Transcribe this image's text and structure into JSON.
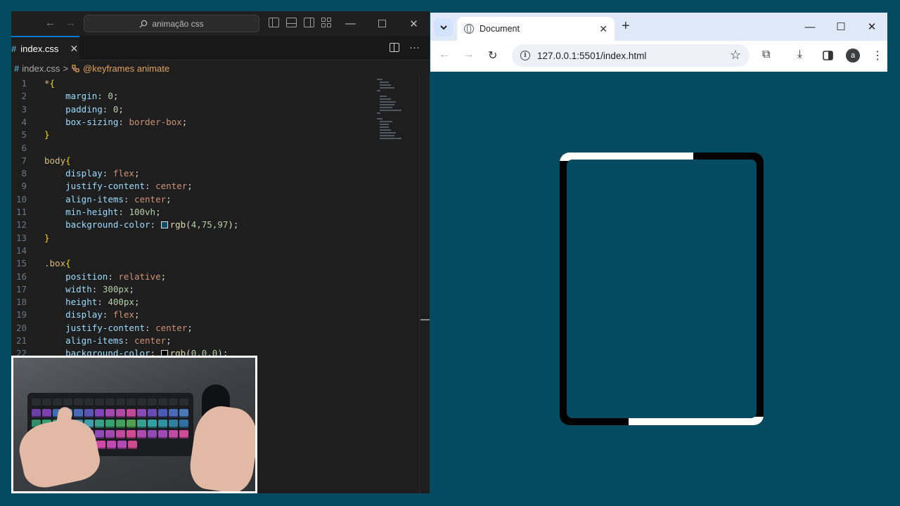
{
  "editor": {
    "nav": {
      "back": "←",
      "forward": "→"
    },
    "search_text": "animação css",
    "window_controls": [
      "—",
      "☐",
      "✕"
    ],
    "tab": {
      "icon": "#",
      "label": "index.css",
      "close": "✕"
    },
    "tab_more": "···",
    "breadcrumb": {
      "icon": "#",
      "file": "index.css",
      "sep": ">",
      "symbol": "@keyframes animate"
    },
    "lines": [
      {
        "n": "1",
        "tokens": [
          [
            "sel",
            "*"
          ],
          [
            "brace",
            "{"
          ]
        ]
      },
      {
        "n": "2",
        "tokens": [
          [
            "pun",
            "    "
          ],
          [
            "prop",
            "margin"
          ],
          [
            "pun",
            ": "
          ],
          [
            "num",
            "0"
          ],
          [
            "pun",
            ";"
          ]
        ]
      },
      {
        "n": "3",
        "tokens": [
          [
            "pun",
            "    "
          ],
          [
            "prop",
            "padding"
          ],
          [
            "pun",
            ": "
          ],
          [
            "num",
            "0"
          ],
          [
            "pun",
            ";"
          ]
        ]
      },
      {
        "n": "4",
        "tokens": [
          [
            "pun",
            "    "
          ],
          [
            "prop",
            "box-sizing"
          ],
          [
            "pun",
            ": "
          ],
          [
            "val",
            "border-box"
          ],
          [
            "pun",
            ";"
          ]
        ]
      },
      {
        "n": "5",
        "tokens": [
          [
            "brace",
            "}"
          ]
        ]
      },
      {
        "n": "6",
        "tokens": []
      },
      {
        "n": "7",
        "tokens": [
          [
            "sel",
            "body"
          ],
          [
            "brace",
            "{"
          ]
        ]
      },
      {
        "n": "8",
        "tokens": [
          [
            "pun",
            "    "
          ],
          [
            "prop",
            "display"
          ],
          [
            "pun",
            ": "
          ],
          [
            "val",
            "flex"
          ],
          [
            "pun",
            ";"
          ]
        ]
      },
      {
        "n": "9",
        "tokens": [
          [
            "pun",
            "    "
          ],
          [
            "prop",
            "justify-content"
          ],
          [
            "pun",
            ": "
          ],
          [
            "val",
            "center"
          ],
          [
            "pun",
            ";"
          ]
        ]
      },
      {
        "n": "10",
        "tokens": [
          [
            "pun",
            "    "
          ],
          [
            "prop",
            "align-items"
          ],
          [
            "pun",
            ": "
          ],
          [
            "val",
            "center"
          ],
          [
            "pun",
            ";"
          ]
        ]
      },
      {
        "n": "11",
        "tokens": [
          [
            "pun",
            "    "
          ],
          [
            "prop",
            "min-height"
          ],
          [
            "pun",
            ": "
          ],
          [
            "num",
            "100vh"
          ],
          [
            "pun",
            ";"
          ]
        ]
      },
      {
        "n": "12",
        "tokens": [
          [
            "pun",
            "    "
          ],
          [
            "prop",
            "background-color"
          ],
          [
            "pun",
            ": "
          ],
          [
            "swatch",
            "#044b61"
          ],
          [
            "fn",
            "rgb"
          ],
          [
            "pun",
            "("
          ],
          [
            "num",
            "4,75,97"
          ],
          [
            "pun",
            ");"
          ]
        ]
      },
      {
        "n": "13",
        "tokens": [
          [
            "brace",
            "}"
          ]
        ]
      },
      {
        "n": "14",
        "tokens": []
      },
      {
        "n": "15",
        "tokens": [
          [
            "sel",
            ".box"
          ],
          [
            "brace",
            "{"
          ]
        ]
      },
      {
        "n": "16",
        "tokens": [
          [
            "pun",
            "    "
          ],
          [
            "prop",
            "position"
          ],
          [
            "pun",
            ": "
          ],
          [
            "val",
            "relative"
          ],
          [
            "pun",
            ";"
          ]
        ]
      },
      {
        "n": "17",
        "tokens": [
          [
            "pun",
            "    "
          ],
          [
            "prop",
            "width"
          ],
          [
            "pun",
            ": "
          ],
          [
            "num",
            "300px"
          ],
          [
            "pun",
            ";"
          ]
        ]
      },
      {
        "n": "18",
        "tokens": [
          [
            "pun",
            "    "
          ],
          [
            "prop",
            "height"
          ],
          [
            "pun",
            ": "
          ],
          [
            "num",
            "400px"
          ],
          [
            "pun",
            ";"
          ]
        ]
      },
      {
        "n": "19",
        "tokens": [
          [
            "pun",
            "    "
          ],
          [
            "prop",
            "display"
          ],
          [
            "pun",
            ": "
          ],
          [
            "val",
            "flex"
          ],
          [
            "pun",
            ";"
          ]
        ]
      },
      {
        "n": "20",
        "tokens": [
          [
            "pun",
            "    "
          ],
          [
            "prop",
            "justify-content"
          ],
          [
            "pun",
            ": "
          ],
          [
            "val",
            "center"
          ],
          [
            "pun",
            ";"
          ]
        ]
      },
      {
        "n": "21",
        "tokens": [
          [
            "pun",
            "    "
          ],
          [
            "prop",
            "align-items"
          ],
          [
            "pun",
            ": "
          ],
          [
            "val",
            "center"
          ],
          [
            "pun",
            ";"
          ]
        ]
      },
      {
        "n": "22",
        "tokens": [
          [
            "pun",
            "    "
          ],
          [
            "prop",
            "background-color"
          ],
          [
            "pun",
            ": "
          ],
          [
            "swatch",
            "#000000"
          ],
          [
            "fn",
            "rgb"
          ],
          [
            "pun",
            "("
          ],
          [
            "num",
            "0,0,0"
          ],
          [
            "pun",
            ");"
          ]
        ]
      }
    ]
  },
  "browser": {
    "tab_title": "Document",
    "tab_close": "✕",
    "new_tab": "+",
    "window_controls": [
      "—",
      "☐",
      "✕"
    ],
    "url": "127.0.0.1:5501/index.html",
    "info_glyph": "i",
    "star": "☆",
    "avatar_letter": "a",
    "nav": {
      "back": "←",
      "forward": "→",
      "reload": "↻"
    },
    "toolbar_icons": {
      "extensions": "⧉",
      "download": "⤓",
      "menu": "⋮"
    }
  },
  "colors": {
    "page_background": "#044b61",
    "box_border": "#000000",
    "box_glow": "#ffffff",
    "accent": "#0078d4"
  }
}
